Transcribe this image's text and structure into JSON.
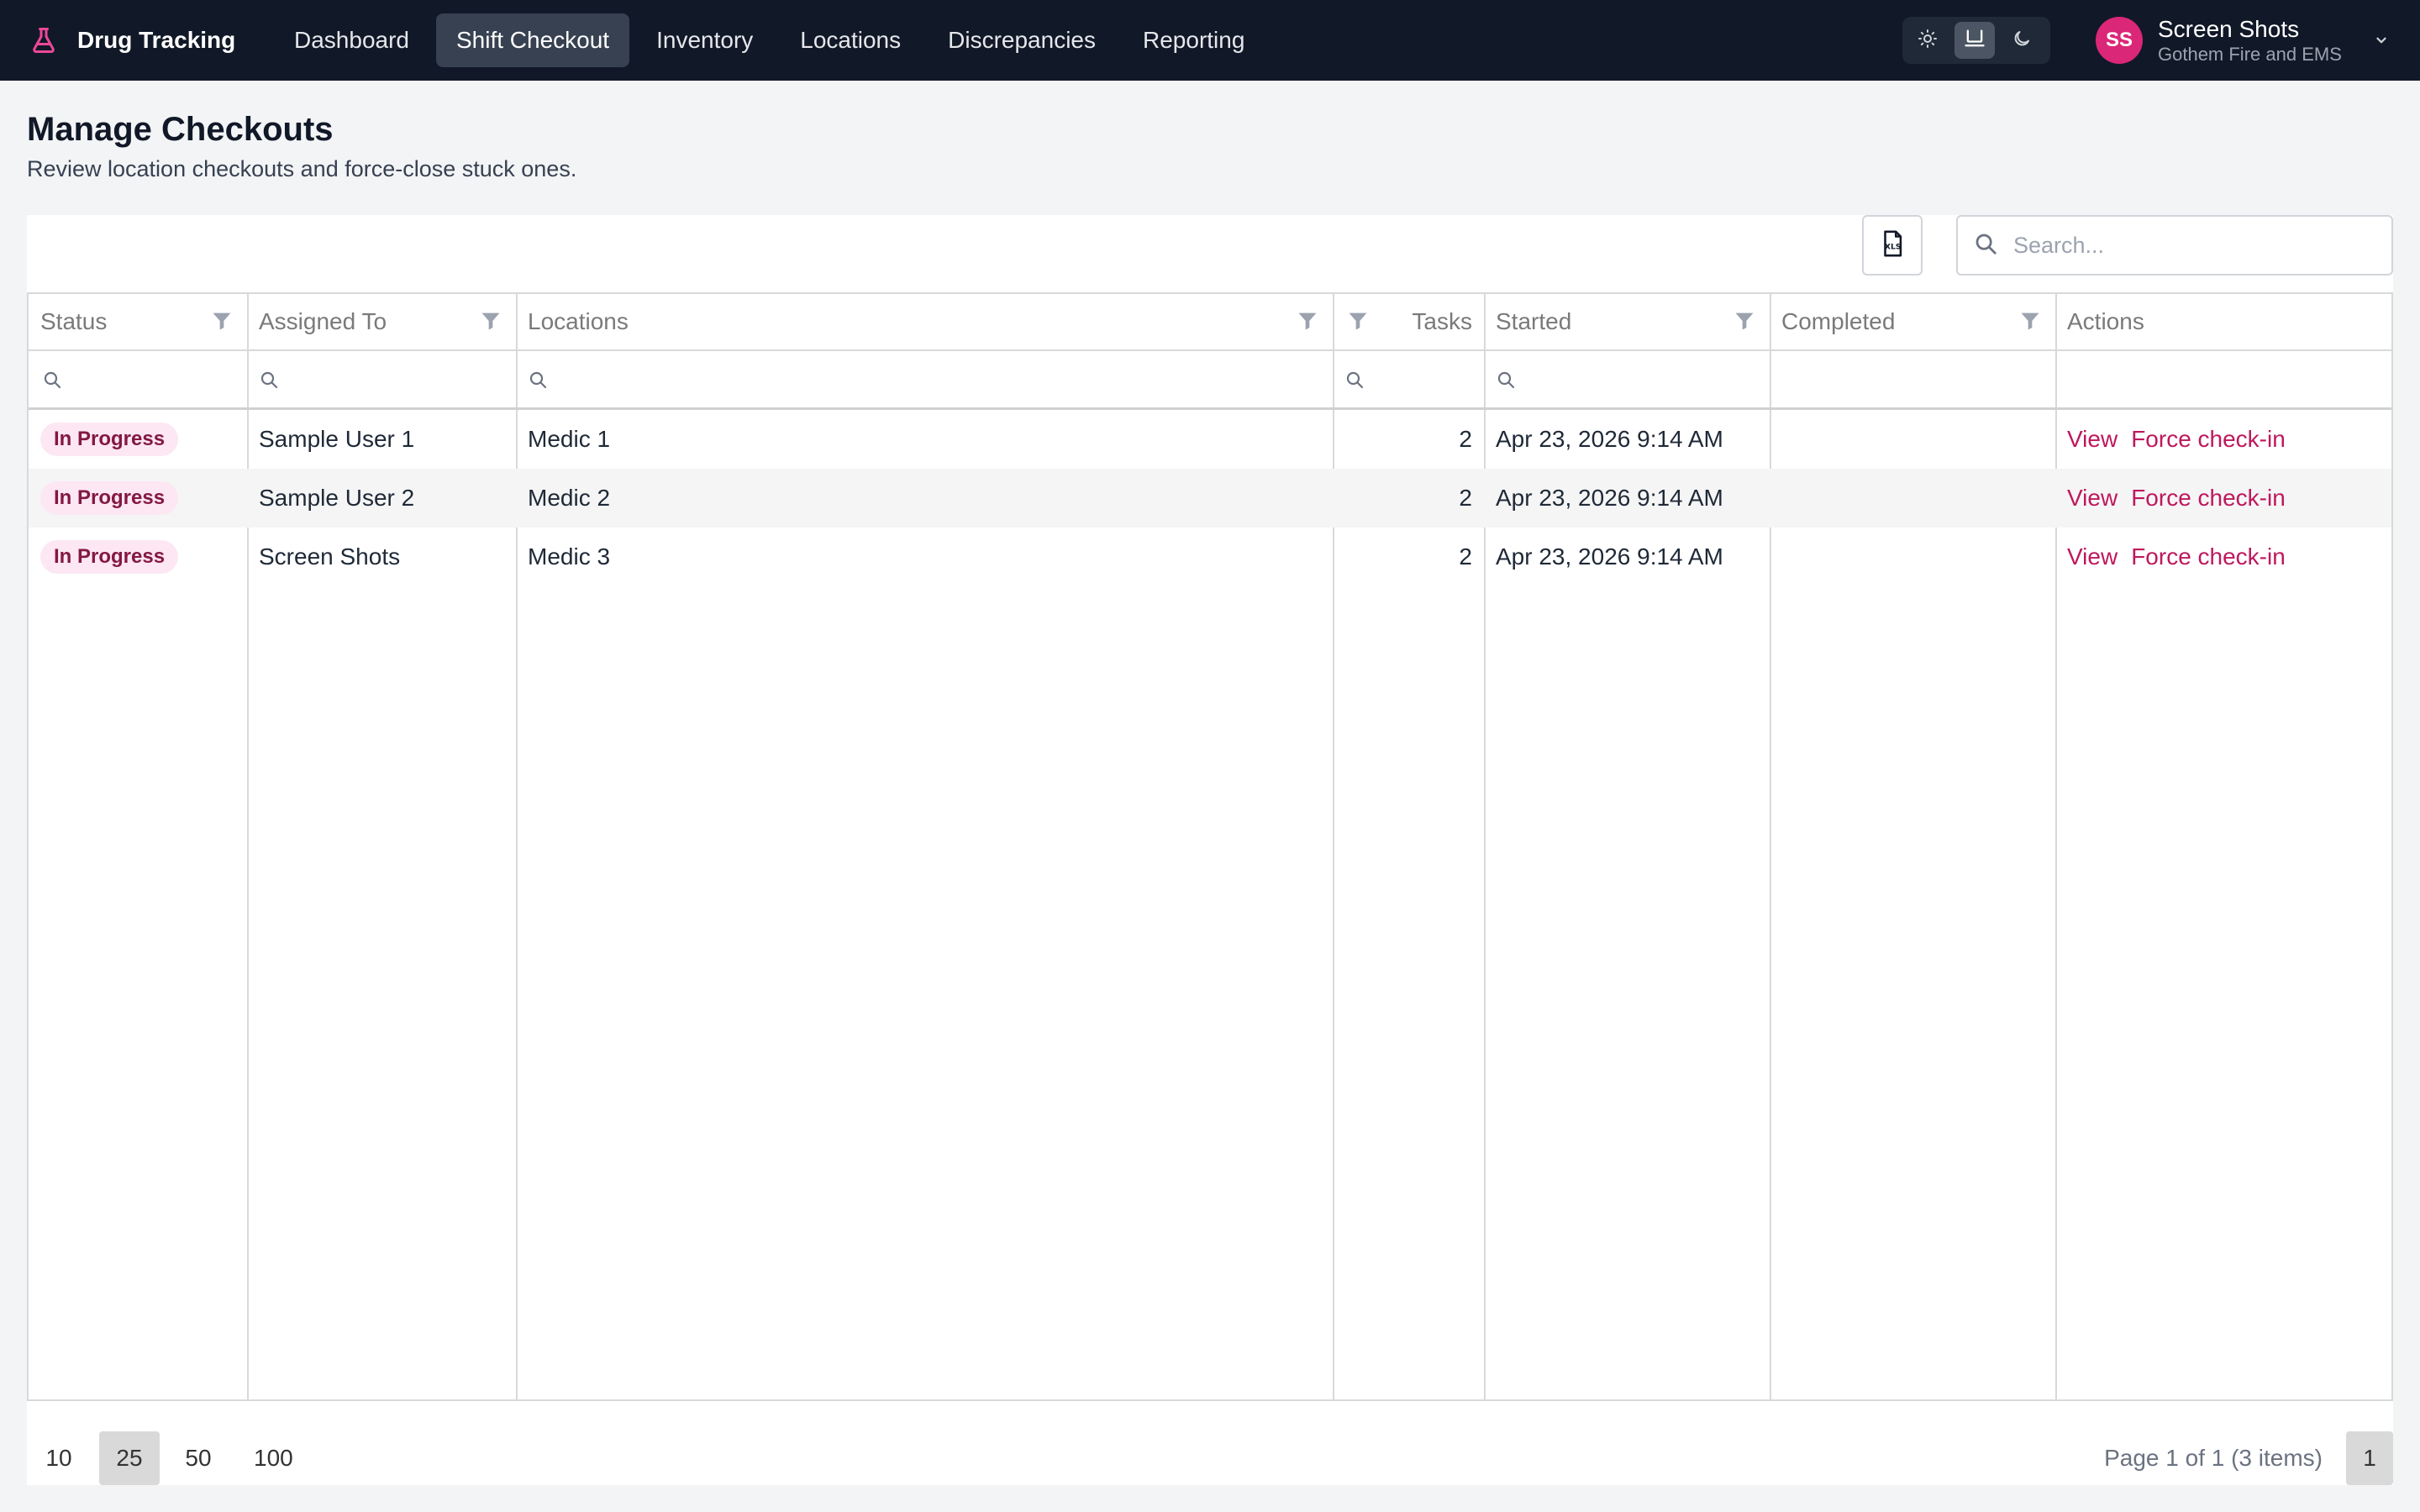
{
  "app": {
    "title": "Drug Tracking",
    "brand_icon": "flask-icon",
    "accent_color": "#db2777"
  },
  "nav": {
    "items": [
      {
        "label": "Dashboard",
        "active": false
      },
      {
        "label": "Shift Checkout",
        "active": true
      },
      {
        "label": "Inventory",
        "active": false
      },
      {
        "label": "Locations",
        "active": false
      },
      {
        "label": "Discrepancies",
        "active": false
      },
      {
        "label": "Reporting",
        "active": false
      }
    ]
  },
  "theme": {
    "options": [
      "sun-icon",
      "monitor-icon",
      "moon-icon"
    ],
    "selected": "monitor-icon"
  },
  "user": {
    "initials": "SS",
    "name": "Screen Shots",
    "org": "Gothem Fire and EMS"
  },
  "page": {
    "title": "Manage Checkouts",
    "subtitle": "Review location checkouts and force-close stuck ones."
  },
  "toolbar": {
    "export_icon": "xlsx-export-icon",
    "search_placeholder": "Search..."
  },
  "table": {
    "columns": {
      "status": "Status",
      "assigned": "Assigned To",
      "locations": "Locations",
      "tasks": "Tasks",
      "started": "Started",
      "completed": "Completed",
      "actions": "Actions"
    },
    "rows": [
      {
        "status": "In Progress",
        "assigned": "Sample User 1",
        "locations": "Medic 1",
        "tasks": "2",
        "started": "Apr 23, 2026 9:14 AM",
        "completed": "",
        "view": "View",
        "force": "Force check-in"
      },
      {
        "status": "In Progress",
        "assigned": "Sample User 2",
        "locations": "Medic 2",
        "tasks": "2",
        "started": "Apr 23, 2026 9:14 AM",
        "completed": "",
        "view": "View",
        "force": "Force check-in"
      },
      {
        "status": "In Progress",
        "assigned": "Screen Shots",
        "locations": "Medic 3",
        "tasks": "2",
        "started": "Apr 23, 2026 9:14 AM",
        "completed": "",
        "view": "View",
        "force": "Force check-in"
      }
    ]
  },
  "pager": {
    "sizes": [
      "10",
      "25",
      "50",
      "100"
    ],
    "selected_size": "25",
    "info": "Page 1 of 1 (3 items)",
    "current_page": "1"
  }
}
